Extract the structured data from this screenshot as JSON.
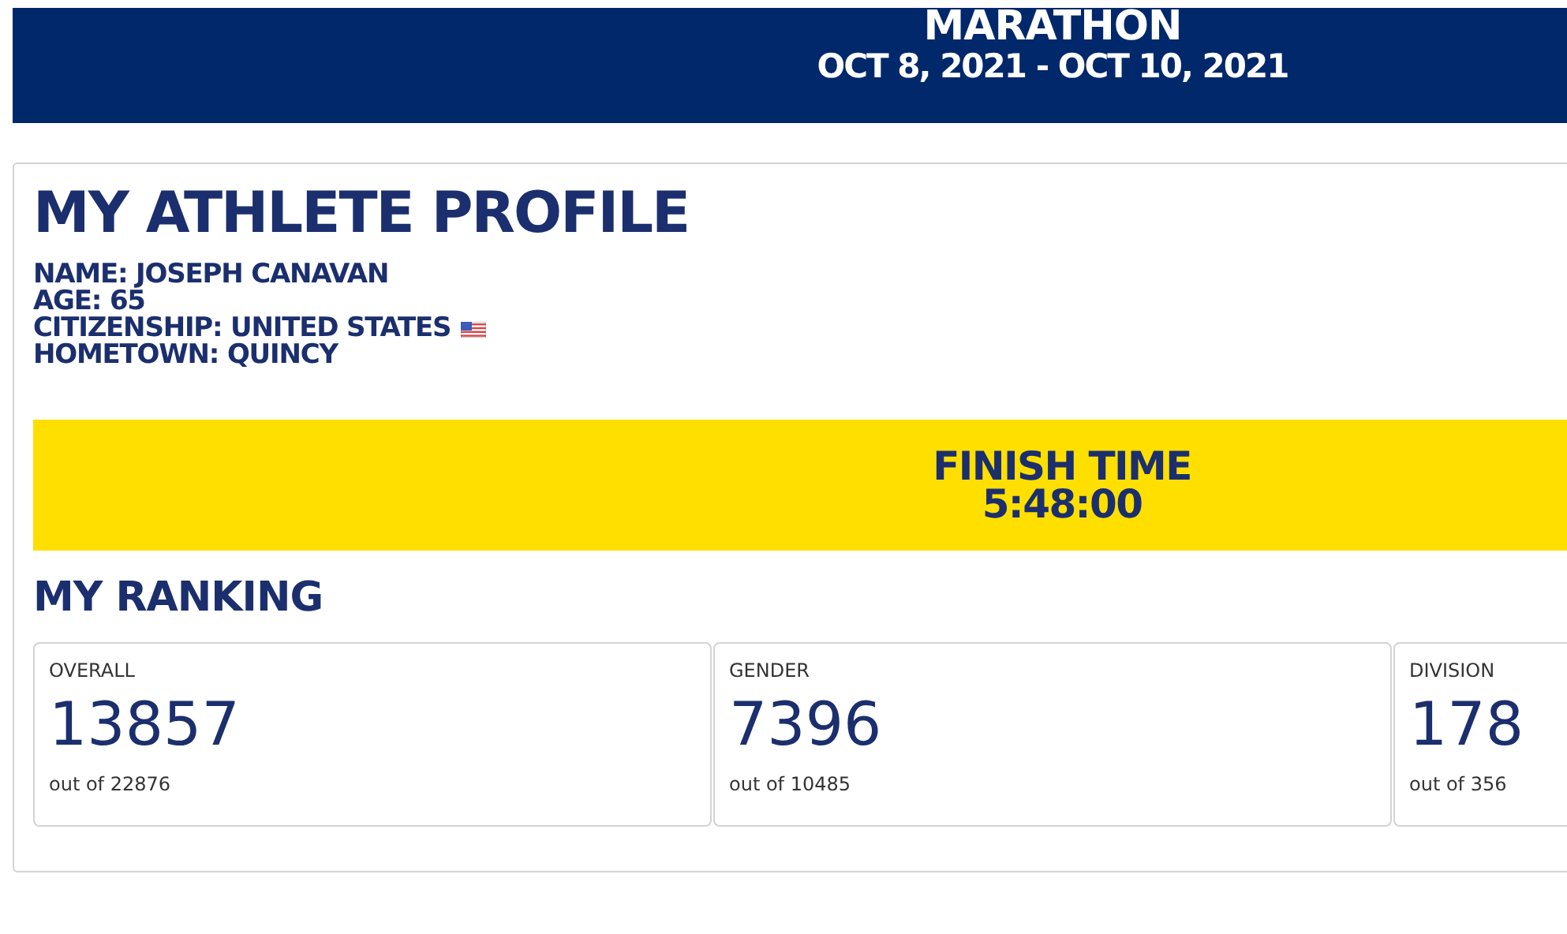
{
  "event": {
    "title": "MARATHON",
    "dates": "OCT 8, 2021 - OCT 10, 2021"
  },
  "profile": {
    "heading": "MY ATHLETE PROFILE",
    "details": [
      {
        "text": "NAME: JOSEPH CANAVAN",
        "flag": false
      },
      {
        "text": "AGE: 65",
        "flag": false
      },
      {
        "text": "CITIZENSHIP: UNITED STATES",
        "flag": true
      },
      {
        "text": "HOMETOWN: QUINCY",
        "flag": false
      }
    ]
  },
  "finish": {
    "label": "FINISH TIME",
    "time": "5:48:00"
  },
  "ranking": {
    "heading": "MY RANKING",
    "cards": [
      {
        "label": "OVERALL",
        "value": "13857",
        "total": "out of 22876"
      },
      {
        "label": "GENDER",
        "value": "7396",
        "total": "out of 10485"
      },
      {
        "label": "DIVISION",
        "value": "178",
        "total": "out of 356"
      }
    ]
  }
}
